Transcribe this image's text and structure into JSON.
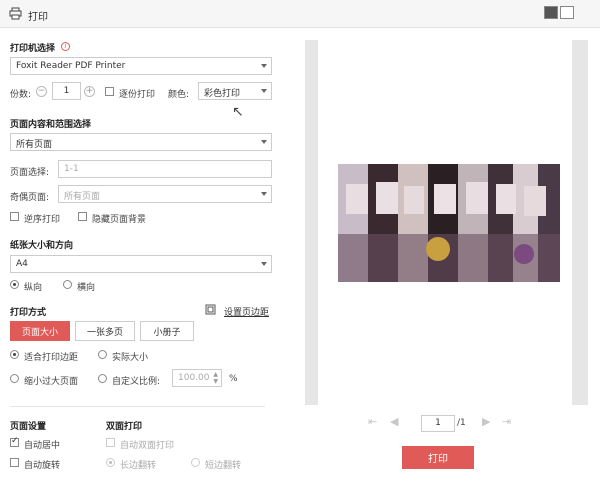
{
  "window": {
    "title": "打印"
  },
  "printer": {
    "section": "打印机选择",
    "selected": "Foxit Reader PDF Printer"
  },
  "copies": {
    "label": "份数:",
    "value": "1",
    "collate_label": "逐份打印",
    "color_label": "颜色:",
    "color_value": "彩色打印"
  },
  "range": {
    "section": "页面内容和范围选择",
    "content_value": "所有页面",
    "page_select_label": "页面选择:",
    "page_select_placeholder": "1-1",
    "odd_even_label": "奇偶页面:",
    "odd_even_value": "所有页面",
    "reverse_label": "逆序打印",
    "hide_bg_label": "隐藏页面背景"
  },
  "paper": {
    "section": "纸张大小和方向",
    "size": "A4",
    "portrait": "纵向",
    "landscape": "横向"
  },
  "print_mode": {
    "section": "打印方式",
    "margin_settings": "设置页边距",
    "tabs": [
      "页面大小",
      "一张多页",
      "小册子"
    ],
    "fit_margins": "适合打印边距",
    "actual_size": "实际大小",
    "shrink_large": "缩小过大页面",
    "custom_scale": "自定义比例:",
    "scale_value": "100.00",
    "scale_unit": "%"
  },
  "page_settings": {
    "section": "页面设置",
    "auto_center": "自动居中",
    "auto_rotate": "自动旋转"
  },
  "duplex": {
    "section": "双面打印",
    "auto_duplex": "自动双面打印",
    "long_edge": "长边翻转",
    "short_edge": "短边翻转"
  },
  "preview": {
    "current_page": "1",
    "total_pages": "/1"
  },
  "actions": {
    "print_label": "打印"
  },
  "colors": {
    "accent": "#e05a57"
  }
}
